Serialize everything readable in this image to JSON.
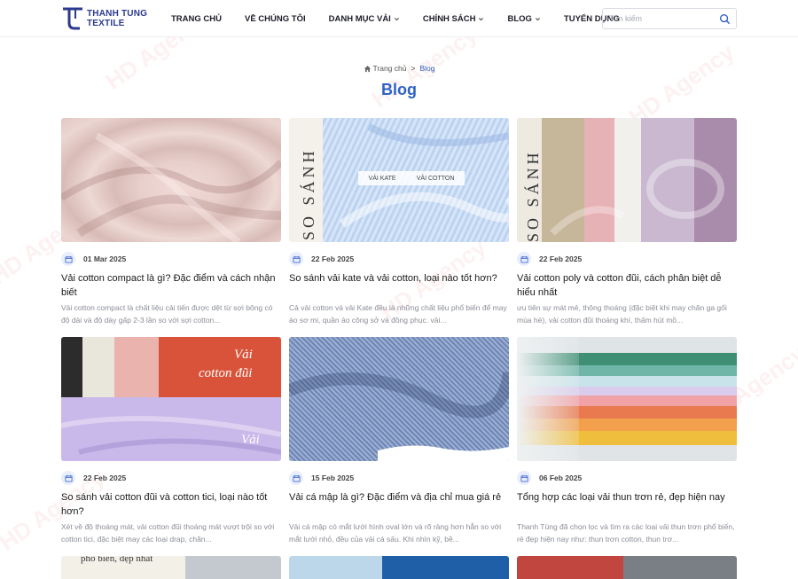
{
  "header": {
    "logo_line1": "THANH TUNG",
    "logo_line2": "TEXTILE",
    "nav": [
      {
        "label": "TRANG CHỦ",
        "has_dropdown": false
      },
      {
        "label": "VỀ CHÚNG TÔI",
        "has_dropdown": false
      },
      {
        "label": "DANH MỤC VẢI",
        "has_dropdown": true
      },
      {
        "label": "CHÍNH SÁCH",
        "has_dropdown": true
      },
      {
        "label": "BLOG",
        "has_dropdown": true
      },
      {
        "label": "TUYỂN DỤNG",
        "has_dropdown": false
      }
    ],
    "search_placeholder": "Tìm kiếm"
  },
  "breadcrumb": {
    "home": "Trang chủ",
    "separator": ">",
    "current": "Blog"
  },
  "page_title": "Blog",
  "posts": [
    {
      "date": "01 Mar 2025",
      "title": "Vải cotton compact là gì? Đặc điểm và cách nhận biết",
      "excerpt": "Vải cotton compact là chất liệu cải tiến được dệt từ sợi bông có độ dài và độ dày gấp 2-3 lần so với sợi cotton..."
    },
    {
      "date": "22 Feb 2025",
      "title": "So sánh vải kate và vải cotton, loại nào tốt hơn?",
      "excerpt": "Cả vải cotton và vải Kate đều là những chất liệu phổ biến để may áo sơ mi, quần áo công sở và đồng phục. vải..."
    },
    {
      "date": "22 Feb 2025",
      "title": "Vải cotton poly và cotton đũi, cách phân biệt dễ hiểu nhất",
      "excerpt": "ưu tiên sự mát mẻ, thông thoáng (đặc biệt khi may chăn ga gối mùa hè), vải cotton đũi thoáng khí, thấm hút mồ..."
    },
    {
      "date": "22 Feb 2025",
      "title": "So sánh vải cotton đũi và cotton tici, loại nào tốt hơn?",
      "excerpt": "Xét về độ thoáng mát, vải cotton đũi thoáng mát vượt trội so với cotton tici, đặc biệt may các loại drap, chăn..."
    },
    {
      "date": "15 Feb 2025",
      "title": "Vải cá mập là gì? Đặc điểm và địa chỉ mua giá rẻ",
      "excerpt": "Vải cá mập có mắt lưới hình oval lớn và rõ ràng hơn hẳn so với mắt lưới nhỏ, đều của vải cá sấu. Khi nhìn kỹ, bề..."
    },
    {
      "date": "06 Feb 2025",
      "title": "Tổng hợp các loại vải thun trơn rẻ, đẹp hiện nay",
      "excerpt": "Thanh Tùng đã chọn lọc và tìm ra các loại vải thun trơn phổ biến, rẻ đẹp hiện nay như: thun trơn cotton, thun trơ..."
    }
  ],
  "image_texts": {
    "so_sanh": "SO SÁNH",
    "vai_kate": "VẢI KATE",
    "vai_cotton": "VẢI COTTON",
    "vai": "Vải",
    "cotton_dui": "cotton đũi",
    "pho_bien_dep_nhat": "phổ biến, đẹp nhất"
  },
  "watermark": "HD Agency",
  "colors": {
    "brand": "#2b3a8c",
    "title_blue": "#2e63c6",
    "breadcrumb_current": "#2f5dbb"
  }
}
